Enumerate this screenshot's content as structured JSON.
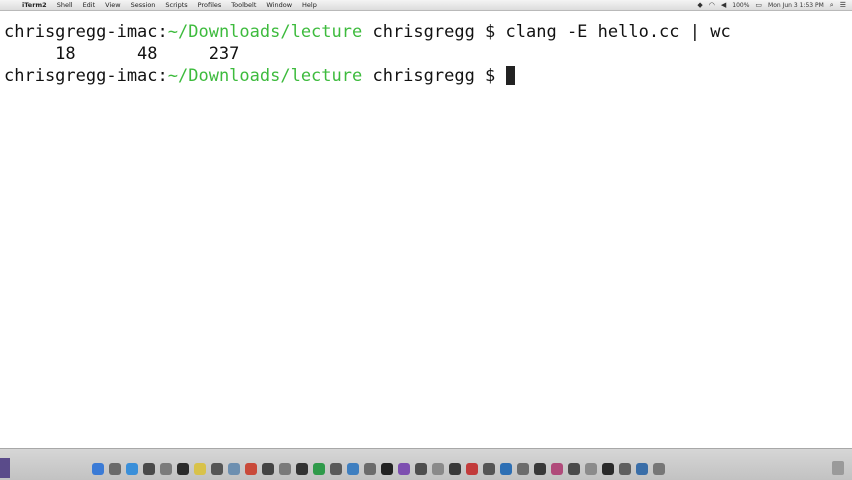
{
  "menubar": {
    "apple": "",
    "items": [
      "iTerm2",
      "Shell",
      "Edit",
      "View",
      "Session",
      "Scripts",
      "Profiles",
      "Toolbelt",
      "Window",
      "Help"
    ],
    "window_title": "",
    "status": {
      "battery": "100%",
      "clock": "Mon Jun 3  1:53 PM"
    }
  },
  "terminal": {
    "line1": {
      "prompt_host": "chrisgregg-imac:",
      "prompt_path": "~/Downloads/lecture",
      "prompt_user": " chrisgregg $ ",
      "command": "clang -E hello.cc | wc"
    },
    "line2": {
      "output": "     18      48     237"
    },
    "line3": {
      "prompt_host": "chrisgregg-imac:",
      "prompt_path": "~/Downloads/lecture",
      "prompt_user": " chrisgregg $ "
    },
    "colors": {
      "path": "#3dbb3d",
      "text": "#111111",
      "cursor": "#222222"
    }
  },
  "dock": {
    "icons": [
      {
        "name": "finder-icon",
        "color": "#3b7bd6"
      },
      {
        "name": "launchpad-icon",
        "color": "#6a6a6a"
      },
      {
        "name": "safari-icon",
        "color": "#3a8fd9"
      },
      {
        "name": "chrome-icon",
        "color": "#4a4a4a"
      },
      {
        "name": "settings-icon",
        "color": "#7b7b7b"
      },
      {
        "name": "terminal-icon",
        "color": "#2b2b2b"
      },
      {
        "name": "notes-icon",
        "color": "#d8c24a"
      },
      {
        "name": "photos-icon",
        "color": "#555555"
      },
      {
        "name": "preview-icon",
        "color": "#6d8fb0"
      },
      {
        "name": "calendar-icon",
        "color": "#c94a3a"
      },
      {
        "name": "app-icon",
        "color": "#444444"
      },
      {
        "name": "app-icon",
        "color": "#7a7a7a"
      },
      {
        "name": "app-icon",
        "color": "#333333"
      },
      {
        "name": "app-icon",
        "color": "#2f9a4a"
      },
      {
        "name": "app-icon",
        "color": "#5a5a5a"
      },
      {
        "name": "app-icon",
        "color": "#3f7fc0"
      },
      {
        "name": "app-icon",
        "color": "#6b6b6b"
      },
      {
        "name": "app-icon",
        "color": "#222222"
      },
      {
        "name": "app-icon",
        "color": "#7d4fb0"
      },
      {
        "name": "app-icon",
        "color": "#4e4e4e"
      },
      {
        "name": "app-icon",
        "color": "#8a8a8a"
      },
      {
        "name": "app-icon",
        "color": "#3a3a3a"
      },
      {
        "name": "app-icon",
        "color": "#c23b3b"
      },
      {
        "name": "app-icon",
        "color": "#555555"
      },
      {
        "name": "app-icon",
        "color": "#2d6fb4"
      },
      {
        "name": "app-icon",
        "color": "#6c6c6c"
      },
      {
        "name": "app-icon",
        "color": "#393939"
      },
      {
        "name": "app-icon",
        "color": "#b04a7a"
      },
      {
        "name": "app-icon",
        "color": "#4a4a4a"
      },
      {
        "name": "app-icon",
        "color": "#8b8b8b"
      },
      {
        "name": "app-icon",
        "color": "#2a2a2a"
      },
      {
        "name": "app-icon",
        "color": "#5f5f5f"
      },
      {
        "name": "app-icon",
        "color": "#3a6ea8"
      },
      {
        "name": "app-icon",
        "color": "#777777"
      }
    ]
  }
}
